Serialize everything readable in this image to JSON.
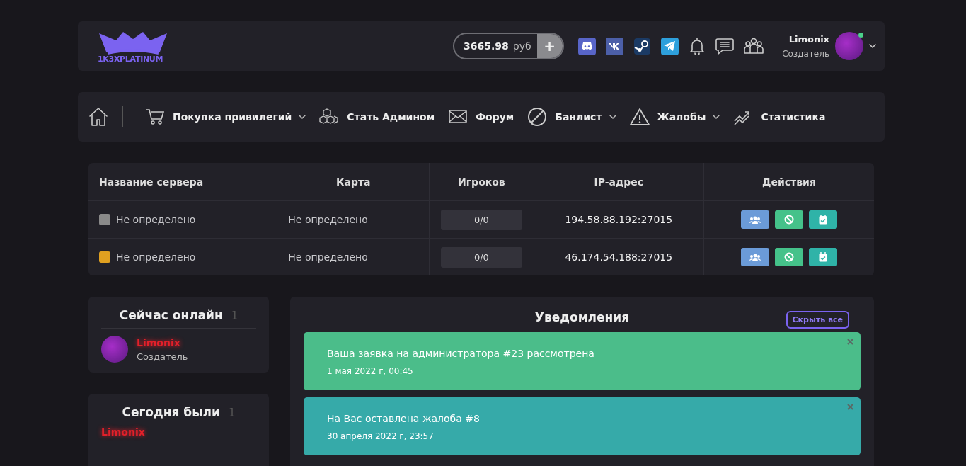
{
  "header": {
    "logo_text": "1K3XPLATINUM",
    "balance": {
      "amount": "3665.98",
      "currency": "руб",
      "add": "+"
    },
    "user": {
      "name": "Limonix",
      "role": "Создатель",
      "online": true
    }
  },
  "nav": [
    {
      "label": "Покупка привилегий",
      "dropdown": true
    },
    {
      "label": "Стать Админом",
      "dropdown": false
    },
    {
      "label": "Форум",
      "dropdown": false
    },
    {
      "label": "Банлист",
      "dropdown": true
    },
    {
      "label": "Жалобы",
      "dropdown": true
    },
    {
      "label": "Статистика",
      "dropdown": false
    }
  ],
  "servers": {
    "columns": [
      "Название сервера",
      "Карта",
      "Игроков",
      "IP-адрес",
      "Действия"
    ],
    "rows": [
      {
        "name": "Не определено",
        "map": "Не определено",
        "players": "0/0",
        "ip": "194.58.88.192:27015"
      },
      {
        "name": "Не определено",
        "map": "Не определено",
        "players": "0/0",
        "ip": "46.174.54.188:27015"
      }
    ]
  },
  "online_now": {
    "title": "Сейчас онлайн",
    "count": "1",
    "users": [
      {
        "name": "Limonix",
        "role": "Создатель"
      }
    ]
  },
  "today": {
    "title": "Сегодня были",
    "count": "1",
    "users": [
      "Limonix"
    ]
  },
  "notifications": {
    "title": "Уведомления",
    "hide_all": "Скрыть все",
    "items": [
      {
        "text": "Ваша заявка на администратора #23 рассмотрена",
        "date": "1 мая 2022 г, 00:45",
        "color": "#4bbd8a"
      },
      {
        "text": "На Вас оставлена жалоба #8",
        "date": "30 апреля 2022 г, 23:57",
        "color": "#36aaa9"
      }
    ]
  }
}
